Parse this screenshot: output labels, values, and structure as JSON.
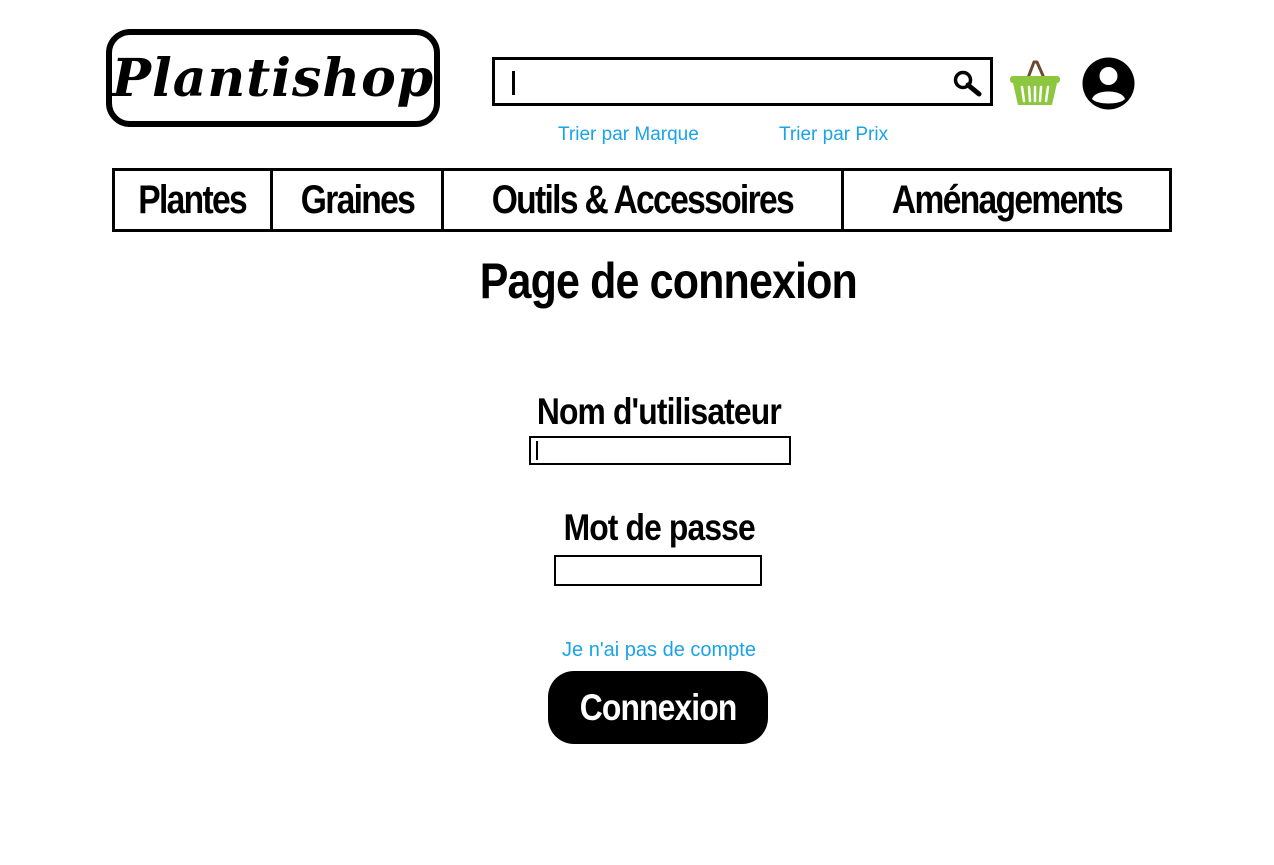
{
  "header": {
    "logo_text": "Plantishop",
    "search": {
      "value": "",
      "placeholder": ""
    },
    "sort_links": {
      "brand": "Trier par Marque",
      "price": "Trier par Prix"
    },
    "icons": {
      "search": "search-icon",
      "basket": "basket-icon",
      "account": "account-icon"
    }
  },
  "categories": [
    {
      "label": "Plantes"
    },
    {
      "label": "Graines"
    },
    {
      "label": "Outils & Accessoires"
    },
    {
      "label": "Aménagements"
    }
  ],
  "login": {
    "title": "Page de connexion",
    "username_label": "Nom d'utilisateur",
    "username_value": "",
    "password_label": "Mot de passe",
    "password_value": "",
    "register_link": "Je n'ai pas de compte",
    "submit_label": "Connexion"
  },
  "colors": {
    "link": "#1aa3e8",
    "primary": "#000000",
    "basket_green": "#8dc63f",
    "basket_handle": "#6b4a2b"
  }
}
